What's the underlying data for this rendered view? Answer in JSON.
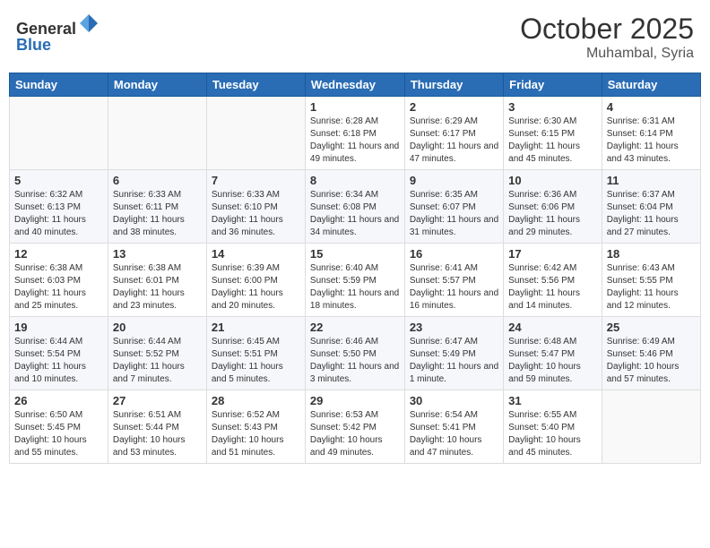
{
  "header": {
    "logo": {
      "line1": "General",
      "line2": "Blue"
    },
    "month": "October 2025",
    "location": "Muhambal, Syria"
  },
  "weekdays": [
    "Sunday",
    "Monday",
    "Tuesday",
    "Wednesday",
    "Thursday",
    "Friday",
    "Saturday"
  ],
  "weeks": [
    [
      {
        "day": "",
        "info": ""
      },
      {
        "day": "",
        "info": ""
      },
      {
        "day": "",
        "info": ""
      },
      {
        "day": "1",
        "info": "Sunrise: 6:28 AM\nSunset: 6:18 PM\nDaylight: 11 hours\nand 49 minutes."
      },
      {
        "day": "2",
        "info": "Sunrise: 6:29 AM\nSunset: 6:17 PM\nDaylight: 11 hours\nand 47 minutes."
      },
      {
        "day": "3",
        "info": "Sunrise: 6:30 AM\nSunset: 6:15 PM\nDaylight: 11 hours\nand 45 minutes."
      },
      {
        "day": "4",
        "info": "Sunrise: 6:31 AM\nSunset: 6:14 PM\nDaylight: 11 hours\nand 43 minutes."
      }
    ],
    [
      {
        "day": "5",
        "info": "Sunrise: 6:32 AM\nSunset: 6:13 PM\nDaylight: 11 hours\nand 40 minutes."
      },
      {
        "day": "6",
        "info": "Sunrise: 6:33 AM\nSunset: 6:11 PM\nDaylight: 11 hours\nand 38 minutes."
      },
      {
        "day": "7",
        "info": "Sunrise: 6:33 AM\nSunset: 6:10 PM\nDaylight: 11 hours\nand 36 minutes."
      },
      {
        "day": "8",
        "info": "Sunrise: 6:34 AM\nSunset: 6:08 PM\nDaylight: 11 hours\nand 34 minutes."
      },
      {
        "day": "9",
        "info": "Sunrise: 6:35 AM\nSunset: 6:07 PM\nDaylight: 11 hours\nand 31 minutes."
      },
      {
        "day": "10",
        "info": "Sunrise: 6:36 AM\nSunset: 6:06 PM\nDaylight: 11 hours\nand 29 minutes."
      },
      {
        "day": "11",
        "info": "Sunrise: 6:37 AM\nSunset: 6:04 PM\nDaylight: 11 hours\nand 27 minutes."
      }
    ],
    [
      {
        "day": "12",
        "info": "Sunrise: 6:38 AM\nSunset: 6:03 PM\nDaylight: 11 hours\nand 25 minutes."
      },
      {
        "day": "13",
        "info": "Sunrise: 6:38 AM\nSunset: 6:01 PM\nDaylight: 11 hours\nand 23 minutes."
      },
      {
        "day": "14",
        "info": "Sunrise: 6:39 AM\nSunset: 6:00 PM\nDaylight: 11 hours\nand 20 minutes."
      },
      {
        "day": "15",
        "info": "Sunrise: 6:40 AM\nSunset: 5:59 PM\nDaylight: 11 hours\nand 18 minutes."
      },
      {
        "day": "16",
        "info": "Sunrise: 6:41 AM\nSunset: 5:57 PM\nDaylight: 11 hours\nand 16 minutes."
      },
      {
        "day": "17",
        "info": "Sunrise: 6:42 AM\nSunset: 5:56 PM\nDaylight: 11 hours\nand 14 minutes."
      },
      {
        "day": "18",
        "info": "Sunrise: 6:43 AM\nSunset: 5:55 PM\nDaylight: 11 hours\nand 12 minutes."
      }
    ],
    [
      {
        "day": "19",
        "info": "Sunrise: 6:44 AM\nSunset: 5:54 PM\nDaylight: 11 hours\nand 10 minutes."
      },
      {
        "day": "20",
        "info": "Sunrise: 6:44 AM\nSunset: 5:52 PM\nDaylight: 11 hours\nand 7 minutes."
      },
      {
        "day": "21",
        "info": "Sunrise: 6:45 AM\nSunset: 5:51 PM\nDaylight: 11 hours\nand 5 minutes."
      },
      {
        "day": "22",
        "info": "Sunrise: 6:46 AM\nSunset: 5:50 PM\nDaylight: 11 hours\nand 3 minutes."
      },
      {
        "day": "23",
        "info": "Sunrise: 6:47 AM\nSunset: 5:49 PM\nDaylight: 11 hours\nand 1 minute."
      },
      {
        "day": "24",
        "info": "Sunrise: 6:48 AM\nSunset: 5:47 PM\nDaylight: 10 hours\nand 59 minutes."
      },
      {
        "day": "25",
        "info": "Sunrise: 6:49 AM\nSunset: 5:46 PM\nDaylight: 10 hours\nand 57 minutes."
      }
    ],
    [
      {
        "day": "26",
        "info": "Sunrise: 6:50 AM\nSunset: 5:45 PM\nDaylight: 10 hours\nand 55 minutes."
      },
      {
        "day": "27",
        "info": "Sunrise: 6:51 AM\nSunset: 5:44 PM\nDaylight: 10 hours\nand 53 minutes."
      },
      {
        "day": "28",
        "info": "Sunrise: 6:52 AM\nSunset: 5:43 PM\nDaylight: 10 hours\nand 51 minutes."
      },
      {
        "day": "29",
        "info": "Sunrise: 6:53 AM\nSunset: 5:42 PM\nDaylight: 10 hours\nand 49 minutes."
      },
      {
        "day": "30",
        "info": "Sunrise: 6:54 AM\nSunset: 5:41 PM\nDaylight: 10 hours\nand 47 minutes."
      },
      {
        "day": "31",
        "info": "Sunrise: 6:55 AM\nSunset: 5:40 PM\nDaylight: 10 hours\nand 45 minutes."
      },
      {
        "day": "",
        "info": ""
      }
    ]
  ]
}
